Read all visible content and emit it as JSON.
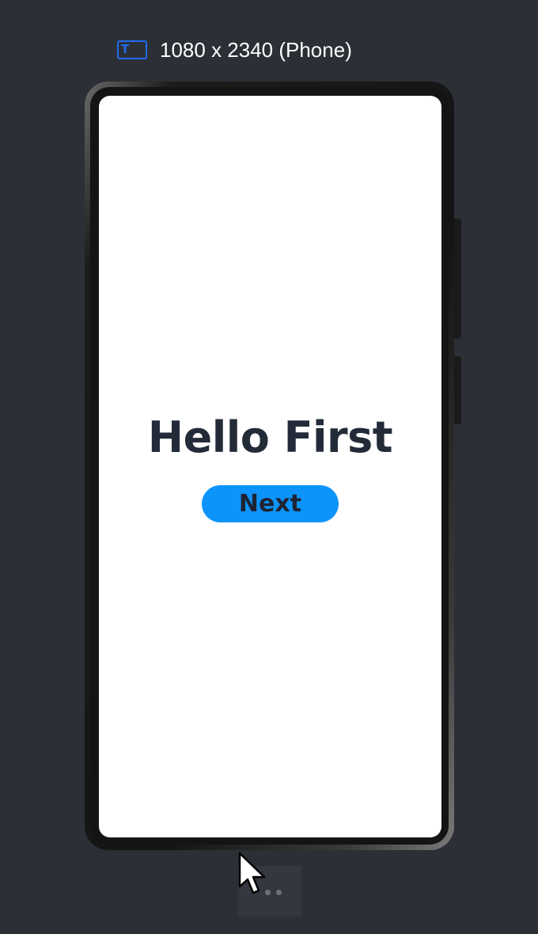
{
  "device": {
    "label": "1080 x 2340 (Phone)",
    "icon": "tablet-text-icon",
    "icon_glyph": "T",
    "icon_color": "#1e6cf0"
  },
  "screen": {
    "title": "Hello First",
    "button_label": "Next",
    "button_color": "#0d94fb",
    "text_color": "#232b38",
    "background": "#ffffff"
  },
  "toolbar": {
    "more_icon": "more-dots-icon"
  },
  "cursor": {
    "icon": "mouse-pointer-icon"
  },
  "colors": {
    "app_background": "#2c2f36"
  }
}
